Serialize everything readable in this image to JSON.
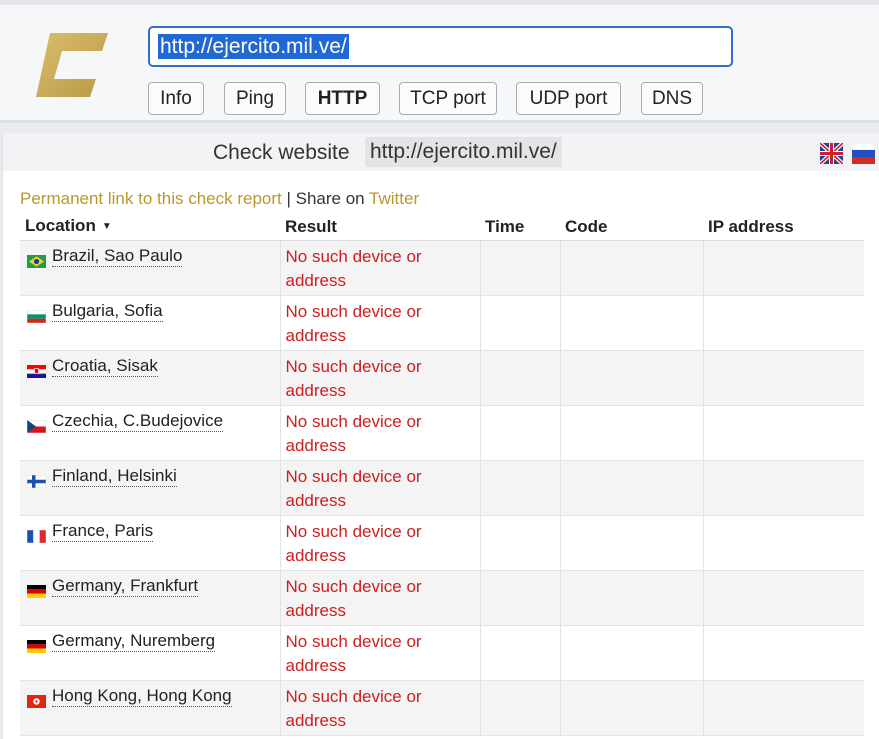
{
  "toolbar": {
    "url_value": "http://ejercito.mil.ve/",
    "tabs": [
      "Info",
      "Ping",
      "HTTP",
      "TCP port",
      "UDP port",
      "DNS"
    ],
    "active_tab": "HTTP"
  },
  "panel": {
    "title": "Check website",
    "url": "http://ejercito.mil.ve/",
    "permalink": "Permanent link to this check report",
    "separator": "|",
    "share_prefix": "Share on",
    "share_target": "Twitter"
  },
  "table": {
    "headers": [
      "Location",
      "Result",
      "Time",
      "Code",
      "IP address"
    ],
    "sort_indicator": "▼",
    "rows": [
      {
        "location": "Brazil, Sao Paulo",
        "flag": "brazil-flag-icon",
        "result": "No such device or address"
      },
      {
        "location": "Bulgaria, Sofia",
        "flag": "bulgaria-flag-icon",
        "result": "No such device or address"
      },
      {
        "location": "Croatia, Sisak",
        "flag": "croatia-flag-icon",
        "result": "No such device or address"
      },
      {
        "location": "Czechia, C.Budejovice",
        "flag": "czechia-flag-icon",
        "result": "No such device or address"
      },
      {
        "location": "Finland, Helsinki",
        "flag": "finland-flag-icon",
        "result": "No such device or address"
      },
      {
        "location": "France, Paris",
        "flag": "france-flag-icon",
        "result": "No such device or address"
      },
      {
        "location": "Germany, Frankfurt",
        "flag": "germany-flag-icon",
        "result": "No such device or address"
      },
      {
        "location": "Germany, Nuremberg",
        "flag": "germany-flag-icon",
        "result": "No such device or address"
      },
      {
        "location": "Hong Kong, Hong Kong",
        "flag": "hong-kong-flag-icon",
        "result": "No such device or address"
      }
    ]
  },
  "colors": {
    "accent_gold": "#b8982a",
    "error_red": "#cc1f1f",
    "selection_blue": "#1f68d6"
  }
}
